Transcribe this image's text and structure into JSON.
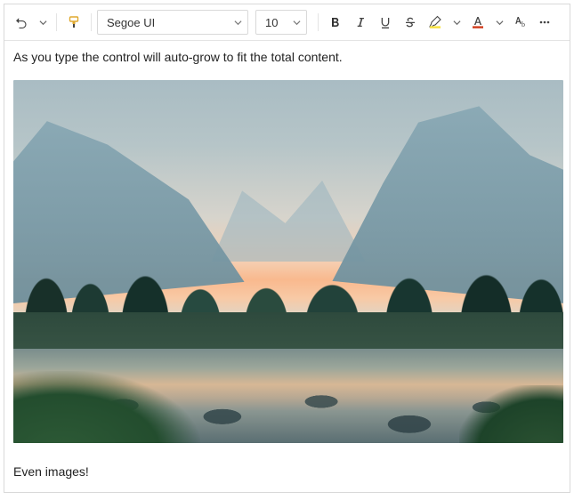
{
  "toolbar": {
    "font_family": "Segoe UI",
    "font_size": "10",
    "icons": {
      "undo": "undo-icon",
      "undo_split": "chevron-down-icon",
      "format_painter": "format-painter-icon",
      "font_caret": "chevron-down-icon",
      "size_caret": "chevron-down-icon",
      "bold": "bold-icon",
      "italic": "italic-icon",
      "underline": "underline-icon",
      "strike": "strikethrough-icon",
      "highlight": "highlight-icon",
      "highlight_caret": "chevron-down-icon",
      "font_color": "font-color-icon",
      "font_color_caret": "chevron-down-icon",
      "clear_format": "clear-formatting-icon",
      "overflow": "more-icon"
    },
    "highlight_swatch": "#f7e13b",
    "font_color_swatch": "#d13c1b"
  },
  "document": {
    "line1": "As you type the control will auto-grow to fit the total content.",
    "line2": "Even images!",
    "image_alt": "Mountain valley with river at sunset"
  }
}
